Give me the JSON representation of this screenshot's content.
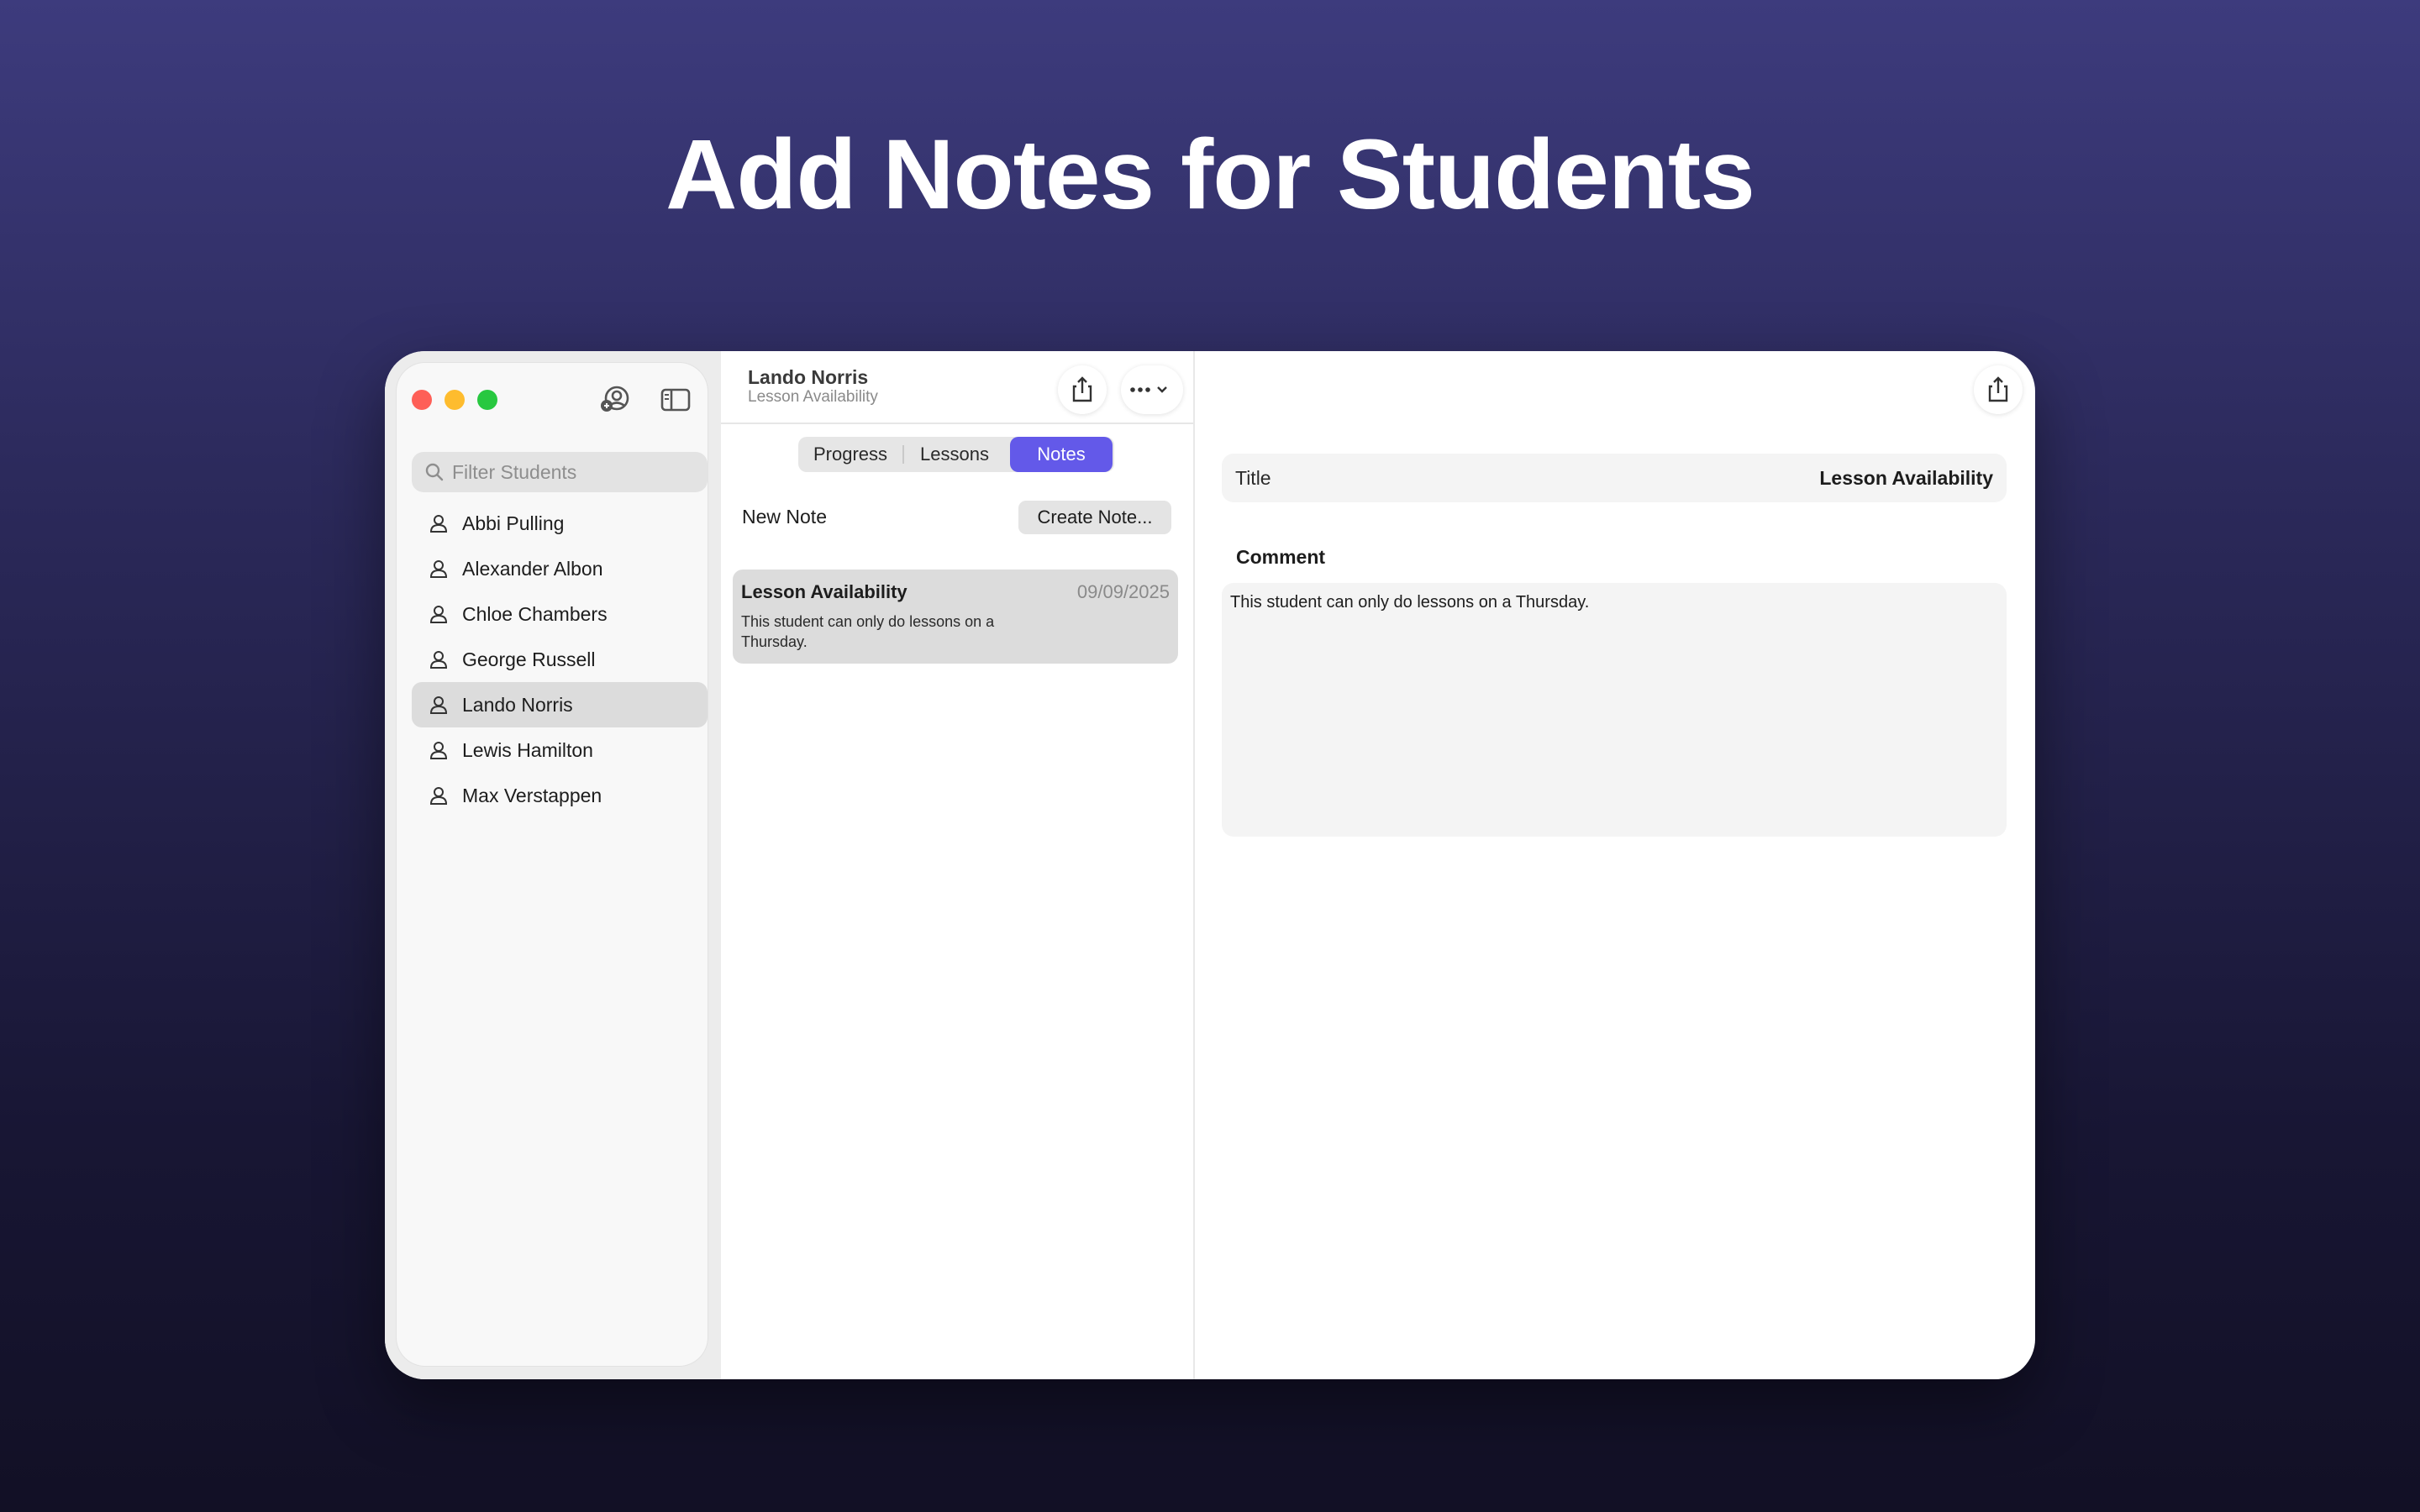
{
  "headline": "Add Notes for Students",
  "sidebar": {
    "search_placeholder": "Filter Students",
    "students": [
      {
        "name": "Abbi Pulling"
      },
      {
        "name": "Alexander Albon"
      },
      {
        "name": "Chloe Chambers"
      },
      {
        "name": "George Russell"
      },
      {
        "name": "Lando Norris",
        "selected": true
      },
      {
        "name": "Lewis Hamilton"
      },
      {
        "name": "Max Verstappen"
      }
    ]
  },
  "middle": {
    "title": "Lando Norris",
    "subtitle": "Lesson Availability",
    "tabs": [
      {
        "label": "Progress"
      },
      {
        "label": "Lessons"
      },
      {
        "label": "Notes",
        "selected": true
      }
    ],
    "new_note_label": "New Note",
    "create_button": "Create Note...",
    "notes": [
      {
        "title": "Lesson Availability",
        "date": "09/09/2025",
        "body": "This student can only do lessons on a Thursday."
      }
    ]
  },
  "detail": {
    "title_label": "Title",
    "title_value": "Lesson Availability",
    "comment_label": "Comment",
    "comment_value": "This student can only do lessons on a Thursday."
  },
  "colors": {
    "accent": "#6359e9",
    "close": "#fe5f57",
    "minimize": "#febc2e",
    "maximize": "#28c840"
  },
  "icons": {
    "students_toolbar": "person-circle-icon",
    "sidebar_toggle": "sidebar-toggle-icon",
    "search": "search-icon",
    "student": "person-icon",
    "share": "share-icon",
    "more": "ellipsis-icon",
    "more_chevron": "chevron-down-icon"
  }
}
